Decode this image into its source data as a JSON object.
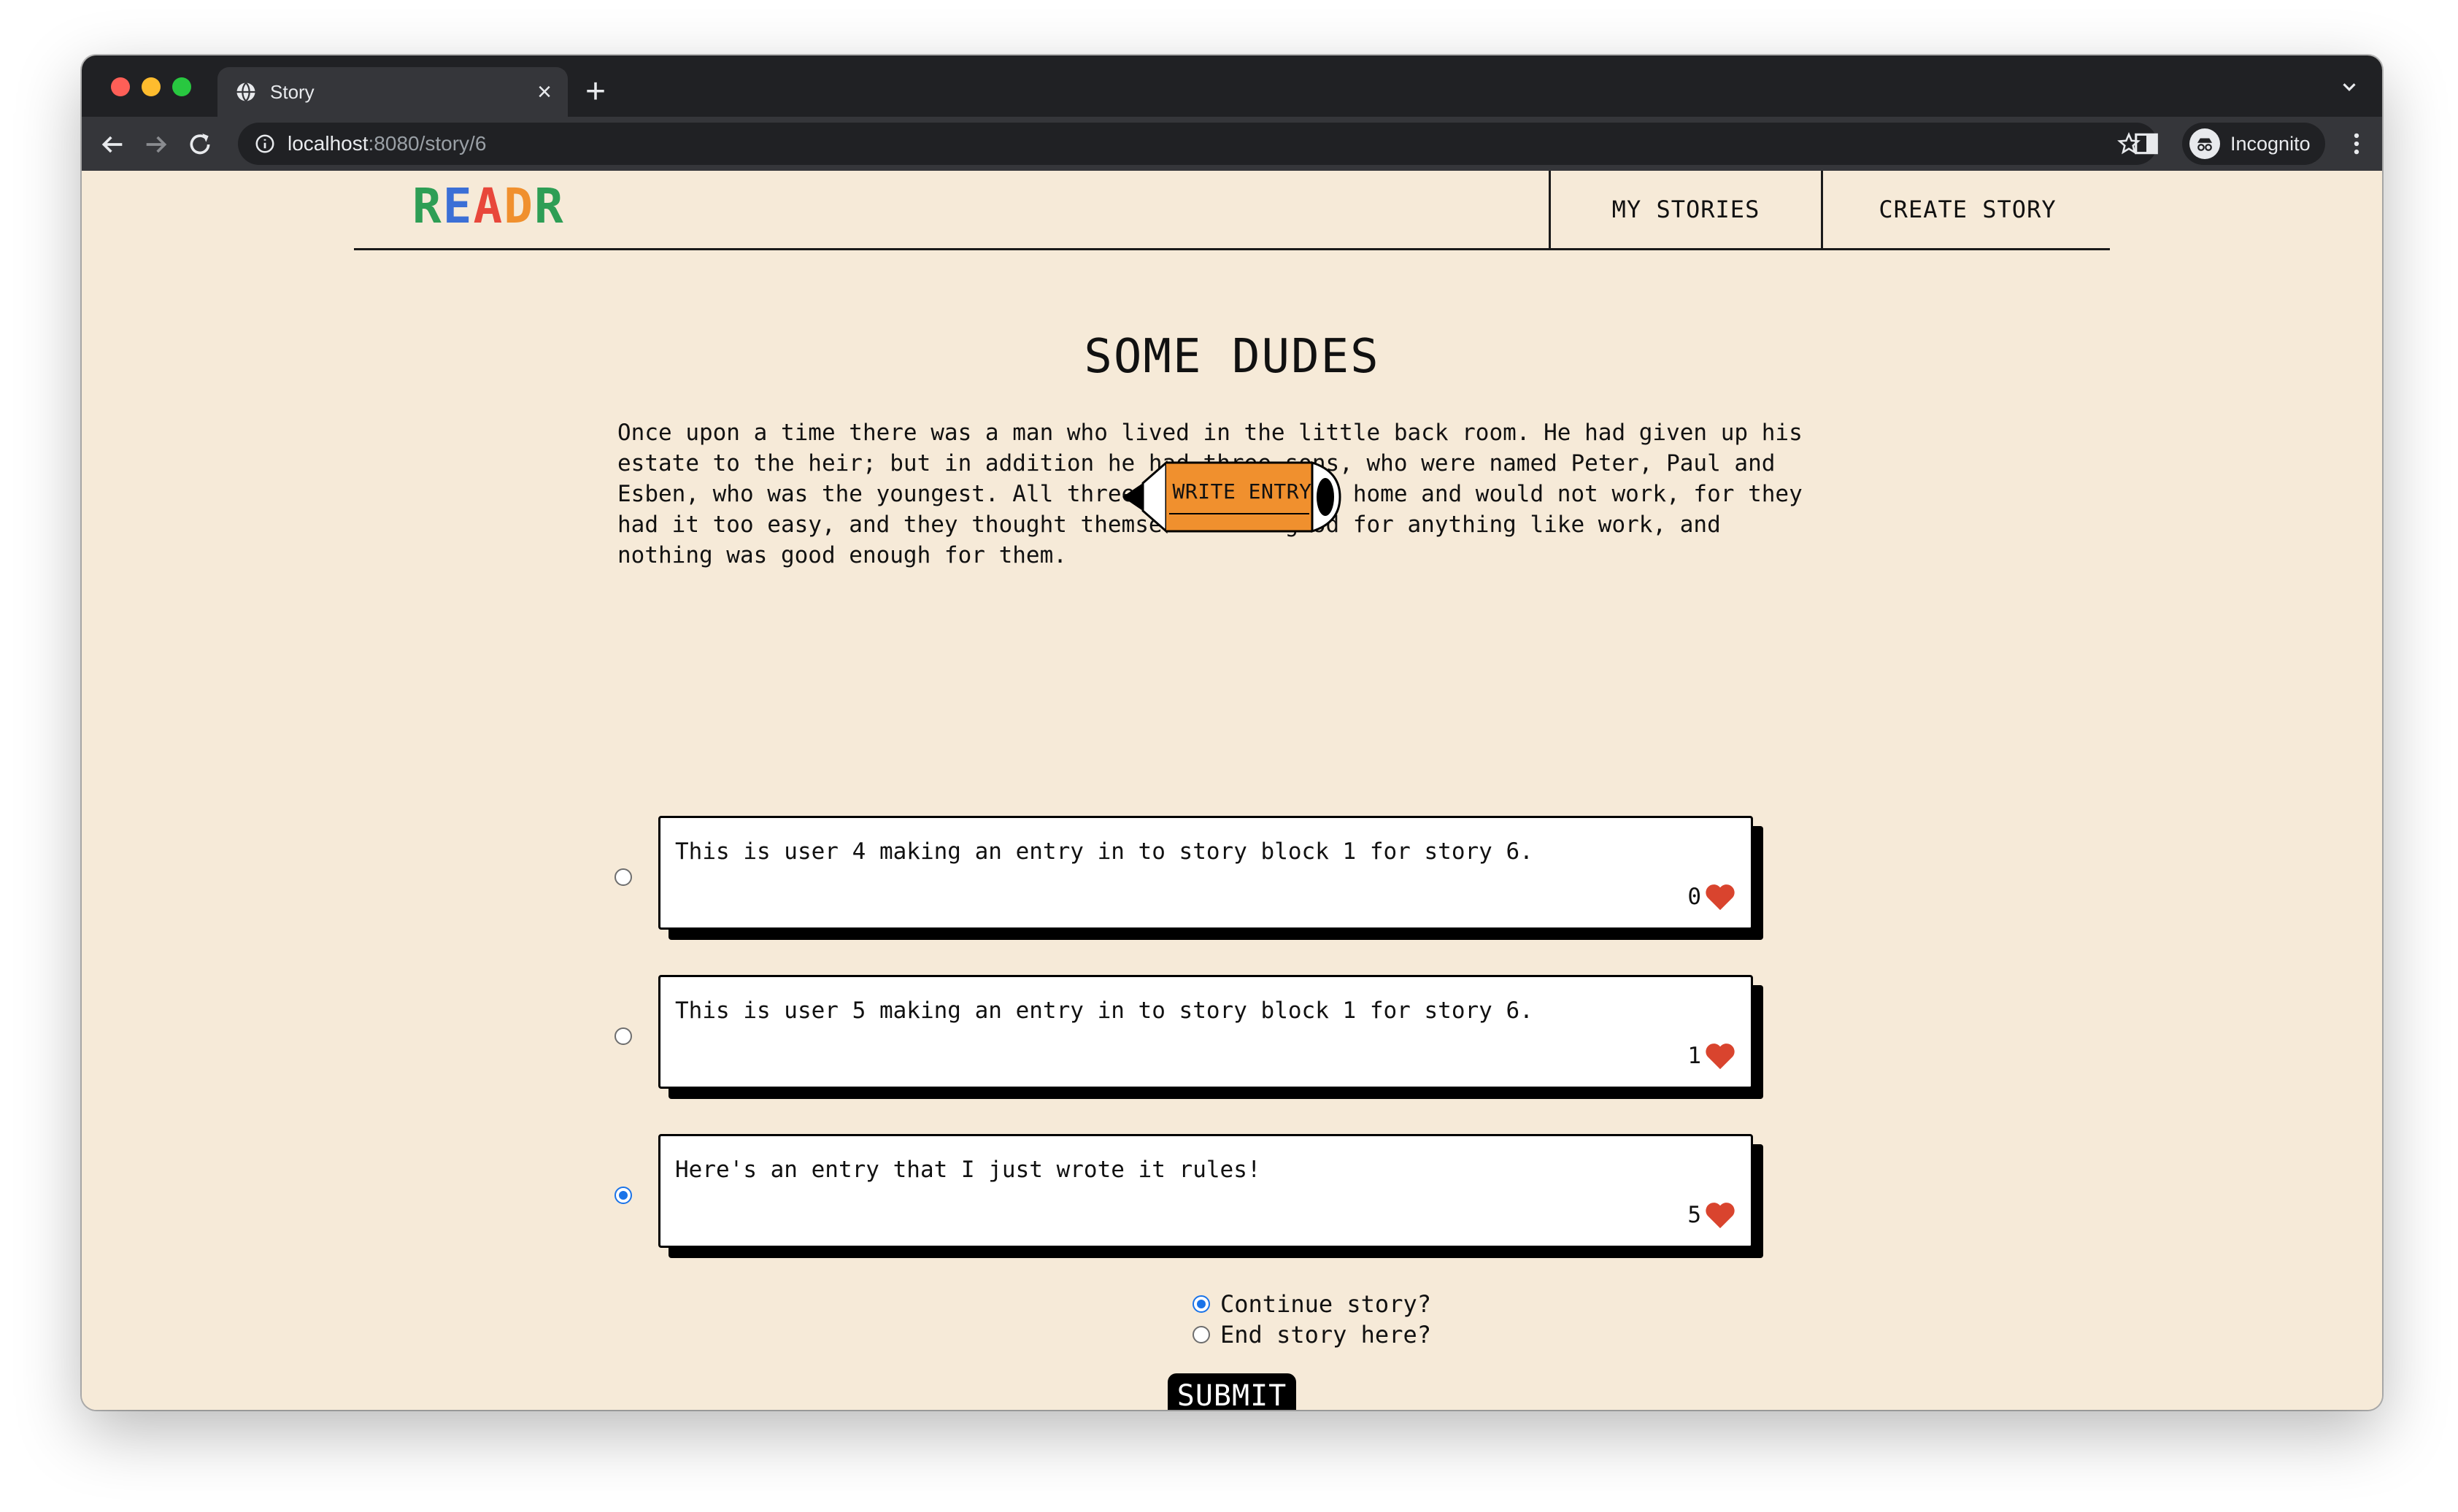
{
  "browser": {
    "tab_title": "Story",
    "tab_close": "×",
    "new_tab": "+",
    "url_host": "localhost",
    "url_rest": ":8080/story/6",
    "profile_label": "Incognito"
  },
  "header": {
    "logo_letters": [
      {
        "char": "R",
        "color": "#2e9e55"
      },
      {
        "char": "E",
        "color": "#3b6fd6"
      },
      {
        "char": "A",
        "color": "#e8473b"
      },
      {
        "char": "D",
        "color": "#f0902e"
      },
      {
        "char": "R",
        "color": "#2e9e55"
      }
    ],
    "nav": {
      "my_stories": "MY STORIES",
      "create_story": "CREATE STORY"
    }
  },
  "story": {
    "title": "SOME DUDES",
    "lines": [
      "Once upon a time there was a man who lived in the little back room. He had given up his",
      "estate to the heir; but in addition he had three sons, who were named Peter, Paul and",
      "Esben, who was the youngest. All three hung around at home and would not work, for they",
      "had it too easy, and they thought themselves too good for anything like work, and",
      "nothing was good enough for them."
    ],
    "write_entry_label": "WRITE ENTRY"
  },
  "entries": [
    {
      "text": "This is user 4 making an entry in to story block 1 for story 6.",
      "likes": "0",
      "selected": false
    },
    {
      "text": "This is user 5 making an entry in to story block 1 for story 6.",
      "likes": "1",
      "selected": false
    },
    {
      "text": "Here's an entry that I just wrote it rules!",
      "likes": "5",
      "selected": true
    }
  ],
  "options": {
    "continue_label": "Continue story?",
    "end_label": "End story here?",
    "selected": "continue"
  },
  "submit_label": "SUBMIT",
  "colors": {
    "page_bg": "#f6ead8",
    "pencil_orange": "#f0902e",
    "heart_red": "#d9442e",
    "radio_blue": "#1a73e8"
  }
}
